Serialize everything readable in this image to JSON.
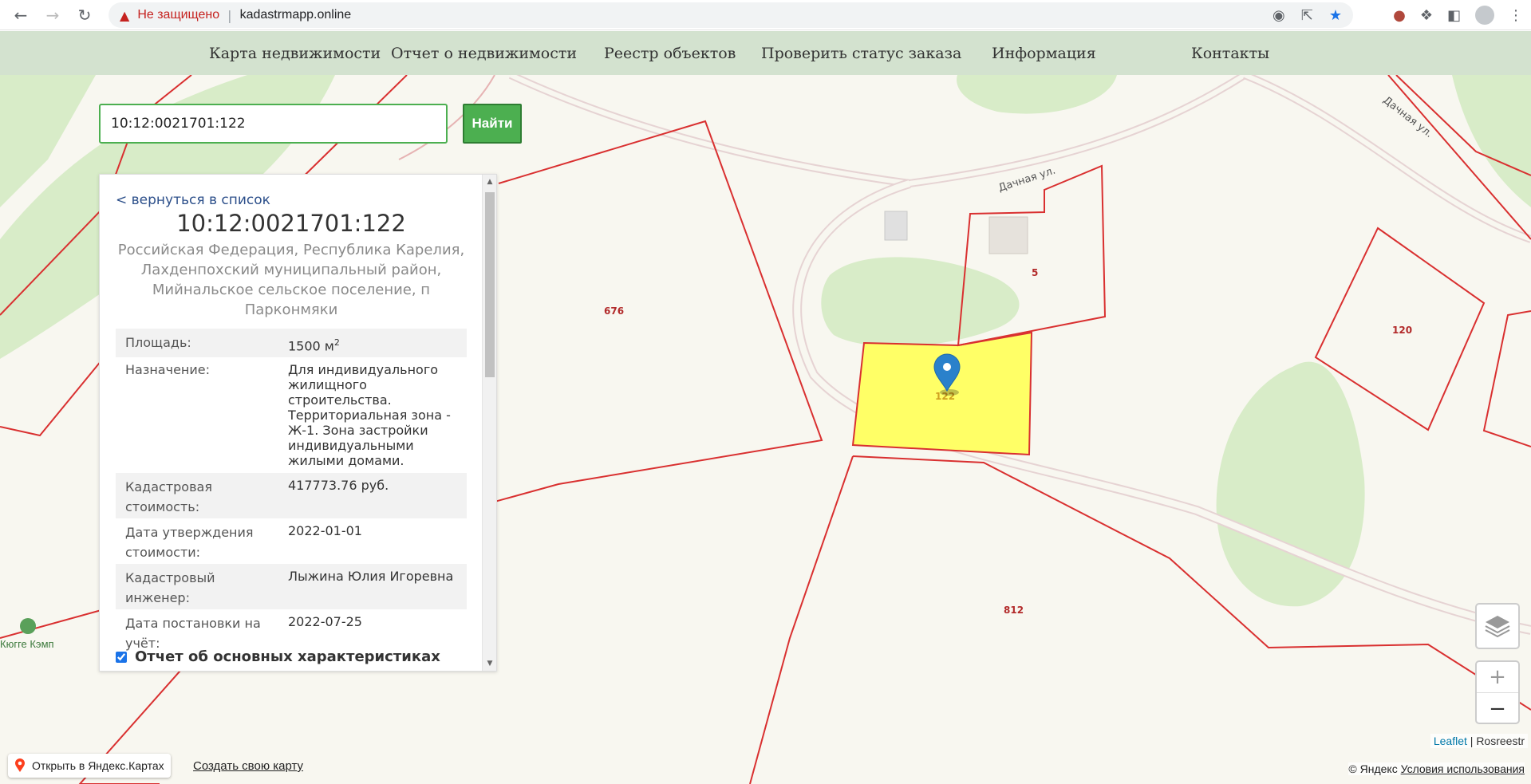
{
  "browser": {
    "security_label": "Не защищено",
    "separator": "|",
    "url": "kadastrmapp.online"
  },
  "sitenav": {
    "items": [
      "Карта недвижимости",
      "Отчет о недвижимости",
      "Реестр объектов",
      "Проверить статус заказа",
      "Информация",
      "Контакты"
    ]
  },
  "search": {
    "value": "10:12:0021701:122",
    "button_label": "Найти"
  },
  "panel": {
    "back_link": "< вернуться в список",
    "cadastral_number": "10:12:0021701:122",
    "address": "Российская Федерация, Республика Карелия, Лахденпохский муниципальный район, Мийнальское сельское поселение, п Парконмяки",
    "rows": [
      {
        "key": "Площадь:",
        "value": "1500 м",
        "sup": "2"
      },
      {
        "key": "Назначение:",
        "value": "Для индивидуального жилищного строительства. Территориальная зона - Ж-1. Зона застройки индивидуальными жилыми домами."
      },
      {
        "key": "Кадастровая стоимость:",
        "value": "417773.76 руб."
      },
      {
        "key": "Дата утверждения стоимости:",
        "value": "2022-01-01"
      },
      {
        "key": "Кадастровый инженер:",
        "value": "Лыжина Юлия Игоревна"
      },
      {
        "key": "Дата постановки на учёт:",
        "value": "2022-07-25"
      }
    ],
    "checkbox_label": "Отчет об основных характеристиках",
    "checkbox_checked": true
  },
  "map": {
    "plot_labels": [
      "676",
      "5",
      "122",
      "120",
      "812"
    ],
    "streets": [
      "Дачная ул.",
      "Дачная ул."
    ],
    "place_label": "Кюгге Кэмп",
    "highlight_color": "#ffff66",
    "boundary_color": "#d93030"
  },
  "controls": {
    "zoom_in": "+",
    "zoom_out": "−"
  },
  "attribution": {
    "leaflet": "Leaflet",
    "separator": " | ",
    "rosreestr": "Rosreestr"
  },
  "yandex": {
    "open_label": "Открыть в Яндекс.Картах",
    "create_label": "Создать свою карту",
    "copyright": "© Яндекс",
    "terms": "Условия использования"
  }
}
